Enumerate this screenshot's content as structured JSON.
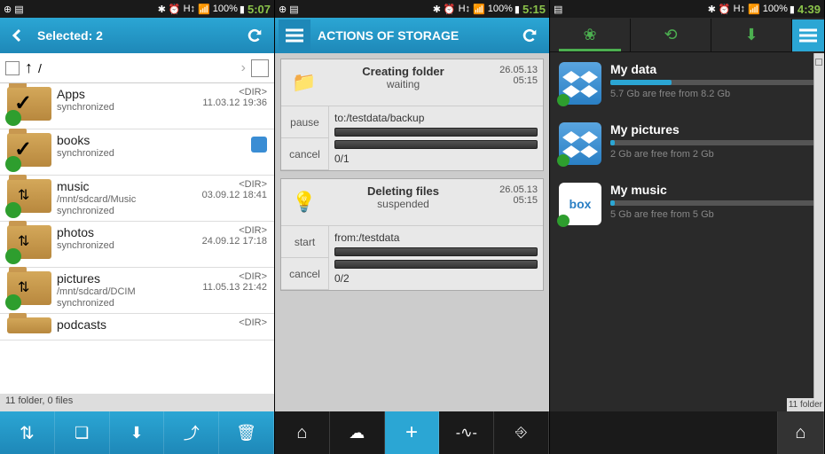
{
  "s1": {
    "clock": "5:07",
    "battery": "100%",
    "header_title": "Selected: 2",
    "path": "/",
    "footer": "11 folder, 0 files",
    "folders": [
      {
        "name": "Apps",
        "status": "synchronized",
        "date": "11.03.12 19:36",
        "dir": "<DIR>",
        "checked": true
      },
      {
        "name": "books",
        "status": "synchronized",
        "date": "",
        "dir": "",
        "checked": true,
        "cloud": true
      },
      {
        "name": "music",
        "path": "/mnt/sdcard/Music",
        "status": "synchronized",
        "date": "03.09.12 18:41",
        "dir": "<DIR>"
      },
      {
        "name": "photos",
        "status": "synchronized",
        "date": "24.09.12 17:18",
        "dir": "<DIR>"
      },
      {
        "name": "pictures",
        "path": "/mnt/sdcard/DCIM",
        "status": "synchronized",
        "date": "11.05.13 21:42",
        "dir": "<DIR>"
      },
      {
        "name": "podcasts",
        "status": "",
        "date": "",
        "dir": "<DIR>"
      }
    ]
  },
  "s2": {
    "clock": "5:15",
    "battery": "100%",
    "header_title": "ACTIONS OF STORAGE",
    "actions": [
      {
        "title": "Creating folder",
        "sub": "waiting",
        "date": "26.05.13",
        "time": "05:15",
        "buttons": [
          "pause",
          "cancel"
        ],
        "path": "to:/testdata/backup",
        "count": "0/1"
      },
      {
        "title": "Deleting files",
        "sub": "suspended",
        "date": "26.05.13",
        "time": "05:15",
        "buttons": [
          "start",
          "cancel"
        ],
        "path": "from:/testdata",
        "count": "0/2"
      }
    ]
  },
  "s3": {
    "clock": "4:39",
    "battery": "100%",
    "storages": [
      {
        "name": "My data",
        "text": "5.7 Gb are free from 8.2 Gb",
        "fill": 30,
        "icon": "dropbox"
      },
      {
        "name": "My pictures",
        "text": "2 Gb are free from 2 Gb",
        "fill": 2,
        "icon": "dropbox"
      },
      {
        "name": "My music",
        "text": "5 Gb are free from 5 Gb",
        "fill": 2,
        "icon": "box"
      }
    ],
    "edge_footer": "11 folder"
  }
}
